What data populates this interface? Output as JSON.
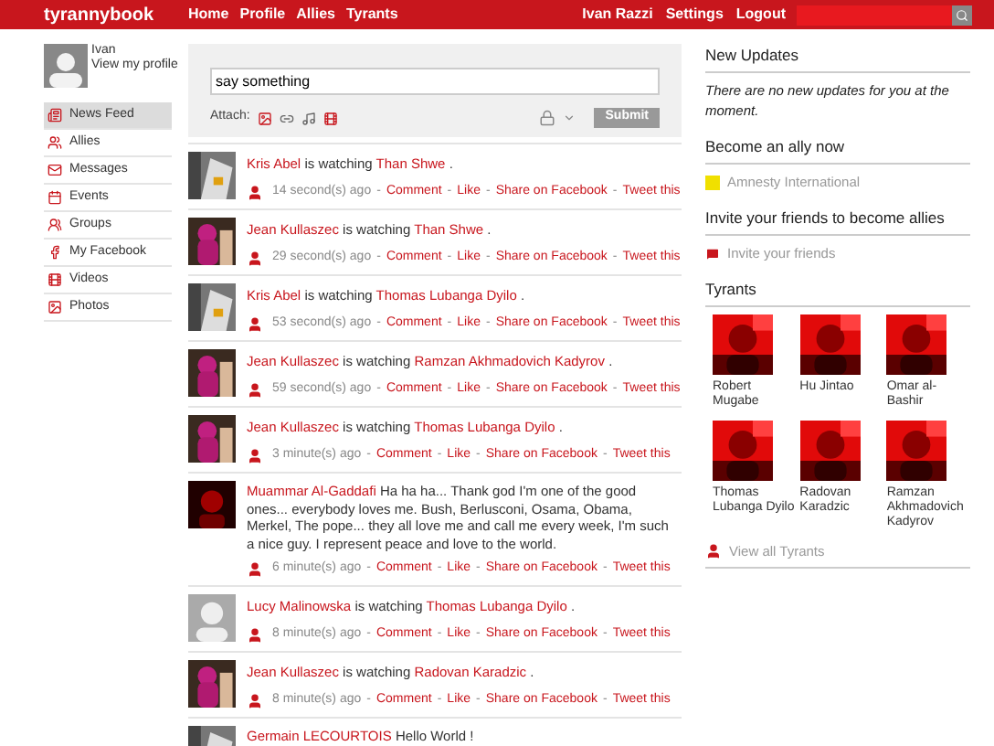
{
  "header": {
    "logo": "tyrannybook",
    "nav": [
      "Home",
      "Profile",
      "Allies",
      "Tyrants"
    ],
    "user_links": [
      "Ivan Razzi",
      "Settings",
      "Logout"
    ]
  },
  "profile": {
    "name": "Ivan",
    "link": "View my profile"
  },
  "sidebar": {
    "items": [
      {
        "label": "News Feed",
        "selected": true
      },
      {
        "label": "Allies",
        "selected": false
      },
      {
        "label": "Messages",
        "selected": false
      },
      {
        "label": "Events",
        "selected": false
      },
      {
        "label": "Groups",
        "selected": false
      },
      {
        "label": "My Facebook",
        "selected": false
      },
      {
        "label": "Videos",
        "selected": false
      },
      {
        "label": "Photos",
        "selected": false
      }
    ]
  },
  "composer": {
    "value": "say something",
    "attach_label": "Attach:",
    "submit": "Submit"
  },
  "feed": [
    {
      "kind": "watching",
      "author": "Kris Abel",
      "verb": "is watching",
      "target": "Than Shwe",
      "end": ".",
      "time": "14 second(s) ago",
      "actions": [
        {
          "sep": "-",
          "label": "Comment"
        },
        {
          "sep": "-",
          "label": "Like"
        },
        {
          "sep": "-",
          "label": "Share on Facebook"
        },
        {
          "sep": "-",
          "label": "Tweet this"
        }
      ]
    },
    {
      "kind": "watching",
      "author": "Jean Kullaszec",
      "verb": "is watching",
      "target": "Than Shwe",
      "end": ".",
      "time": "29 second(s) ago",
      "actions": [
        {
          "sep": "-",
          "label": "Comment"
        },
        {
          "sep": "-",
          "label": "Like"
        },
        {
          "sep": "-",
          "label": "Share on Facebook"
        },
        {
          "sep": "-",
          "label": "Tweet this"
        }
      ]
    },
    {
      "kind": "watching",
      "author": "Kris Abel",
      "verb": "is watching",
      "target": "Thomas Lubanga Dyilo",
      "end": ".",
      "time": "53 second(s) ago",
      "actions": [
        {
          "sep": "-",
          "label": "Comment"
        },
        {
          "sep": "-",
          "label": "Like"
        },
        {
          "sep": "-",
          "label": "Share on Facebook"
        },
        {
          "sep": "-",
          "label": "Tweet this"
        }
      ]
    },
    {
      "kind": "watching",
      "author": "Jean Kullaszec",
      "verb": "is watching",
      "target": "Ramzan Akhmadovich Kadyrov",
      "end": ".",
      "time": "59 second(s) ago",
      "actions": [
        {
          "sep": "-",
          "label": "Comment"
        },
        {
          "sep": "-",
          "label": "Like"
        },
        {
          "sep": "-",
          "label": "Share on Facebook"
        },
        {
          "sep": "-",
          "label": "Tweet this"
        }
      ]
    },
    {
      "kind": "watching",
      "author": "Jean Kullaszec",
      "verb": "is watching",
      "target": "Thomas Lubanga Dyilo",
      "end": ".",
      "time": "3 minute(s) ago",
      "actions": [
        {
          "sep": "-",
          "label": "Comment"
        },
        {
          "sep": "-",
          "label": "Like"
        },
        {
          "sep": "-",
          "label": "Share on Facebook"
        },
        {
          "sep": "-",
          "label": "Tweet this"
        }
      ]
    },
    {
      "kind": "status",
      "author": "Muammar Al-Gaddafi",
      "text": "Ha ha ha... Thank god I'm one of the good ones... everybody loves me. Bush, Berlusconi, Osama, Obama, Merkel, The pope... they all love me and call me every week, I'm such a nice guy. I represent peace and love to the world.",
      "time": "6 minute(s) ago",
      "actions": [
        {
          "sep": "-",
          "label": "Comment"
        },
        {
          "sep": "-",
          "label": "Like"
        },
        {
          "sep": "-",
          "label": "Share on Facebook"
        },
        {
          "sep": "-",
          "label": "Tweet this"
        }
      ]
    },
    {
      "kind": "watching",
      "author": "Lucy Malinowska",
      "verb": "is watching",
      "target": "Thomas Lubanga Dyilo",
      "end": ".",
      "time": "8 minute(s) ago",
      "actions": [
        {
          "sep": "-",
          "label": "Comment"
        },
        {
          "sep": "-",
          "label": "Like"
        },
        {
          "sep": "-",
          "label": "Share on Facebook"
        },
        {
          "sep": "-",
          "label": "Tweet this"
        }
      ]
    },
    {
      "kind": "watching",
      "author": "Jean Kullaszec",
      "verb": "is watching",
      "target": "Radovan Karadzic",
      "end": ".",
      "time": "8 minute(s) ago",
      "actions": [
        {
          "sep": "-",
          "label": "Comment"
        },
        {
          "sep": "-",
          "label": "Like"
        },
        {
          "sep": "-",
          "label": "Share on Facebook"
        },
        {
          "sep": "-",
          "label": "Tweet this"
        }
      ]
    },
    {
      "kind": "status",
      "author": "Germain LECOURTOIS",
      "text": "Hello World !"
    }
  ],
  "updates": {
    "title": "New Updates",
    "message": "There are no new updates for you at the moment."
  },
  "ally": {
    "title": "Become an ally now",
    "link": "Amnesty International"
  },
  "invite": {
    "title": "Invite your friends to become allies",
    "link": "Invite your friends"
  },
  "tyrants": {
    "title": "Tyrants",
    "items": [
      "Robert Mugabe",
      "Hu Jintao",
      "Omar al-Bashir",
      "Thomas Lubanga Dyilo",
      "Radovan Karadzic",
      "Ramzan Akhmadovich Kadyrov"
    ],
    "view_all": "View all Tyrants"
  }
}
